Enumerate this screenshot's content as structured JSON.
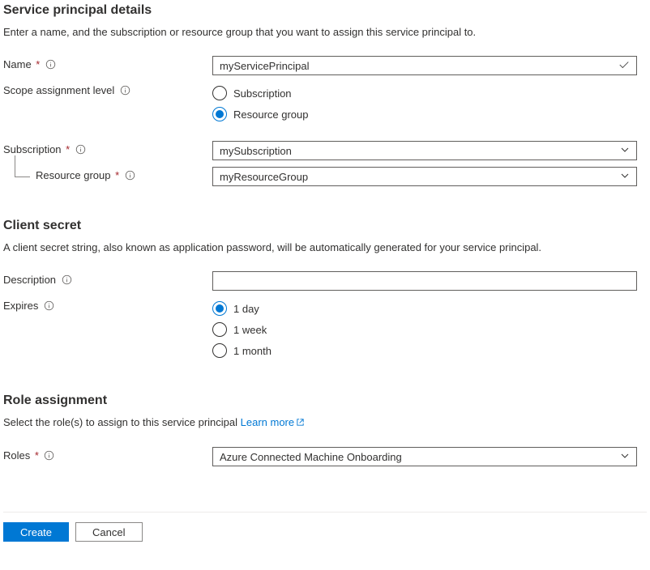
{
  "spd": {
    "heading": "Service principal details",
    "desc": "Enter a name, and the subscription or resource group that you want to assign this service principal to.",
    "name_label": "Name",
    "name_value": "myServicePrincipal",
    "scope_label": "Scope assignment level",
    "scope_options": {
      "subscription": "Subscription",
      "resource_group": "Resource group"
    },
    "subscription_label": "Subscription",
    "subscription_value": "mySubscription",
    "rg_label": "Resource group",
    "rg_value": "myResourceGroup"
  },
  "secret": {
    "heading": "Client secret",
    "desc": "A client secret string, also known as application password, will be automatically generated for your service principal.",
    "description_label": "Description",
    "description_value": "",
    "expires_label": "Expires",
    "expires_options": {
      "d1": "1 day",
      "w1": "1 week",
      "m1": "1 month"
    }
  },
  "role": {
    "heading": "Role assignment",
    "desc_prefix": "Select the role(s) to assign to this service principal ",
    "learn_more": "Learn more",
    "roles_label": "Roles",
    "roles_value": "Azure Connected Machine Onboarding"
  },
  "footer": {
    "create": "Create",
    "cancel": "Cancel"
  }
}
